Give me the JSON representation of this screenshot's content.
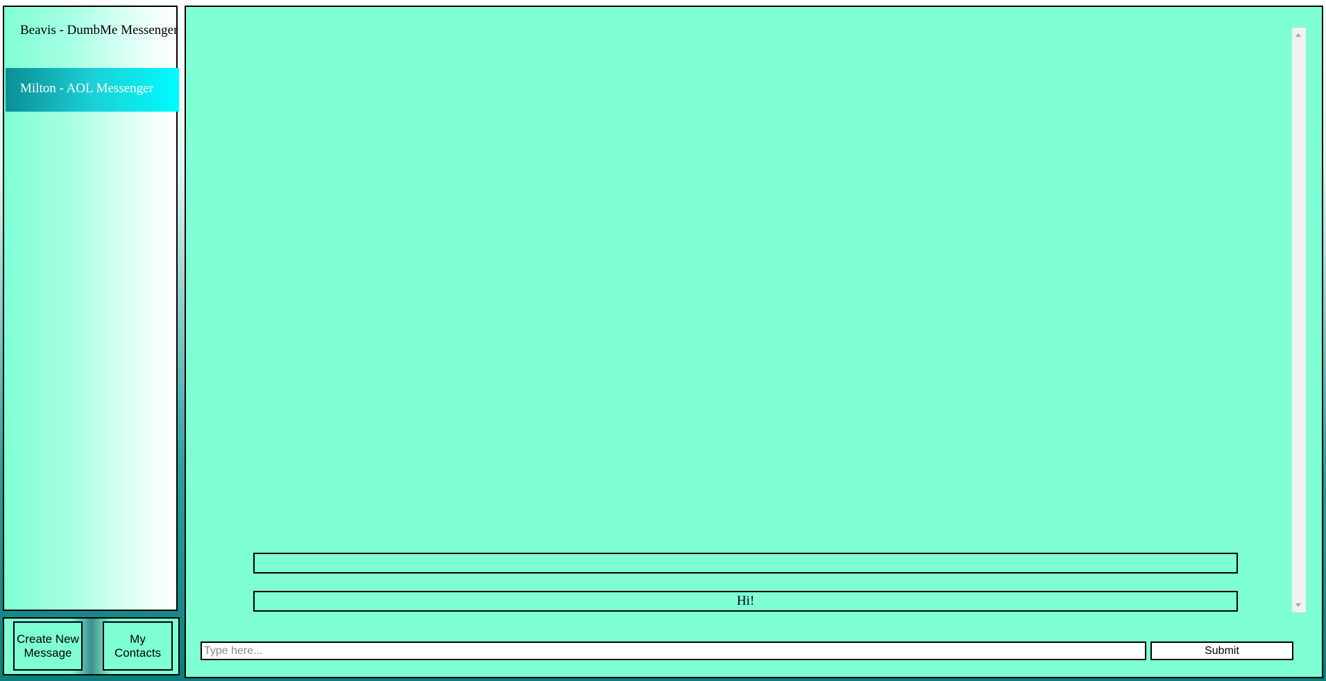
{
  "sidebar": {
    "conversations": [
      {
        "label": "Beavis - DumbMe Messenger",
        "selected": false
      },
      {
        "label": "Milton - AOL Messenger",
        "selected": true
      }
    ]
  },
  "bottom_bar": {
    "create_label": "Create New Message",
    "contacts_label": "My Contacts"
  },
  "chat": {
    "messages": [
      {
        "text": ""
      },
      {
        "text": "Hi!"
      }
    ]
  },
  "compose": {
    "value": "",
    "placeholder": "Type here...",
    "submit_label": "Submit"
  },
  "colors": {
    "panel_bg": "#7fffd4",
    "selected_item_start": "#0a8f95",
    "selected_item_end": "#00fbff"
  }
}
